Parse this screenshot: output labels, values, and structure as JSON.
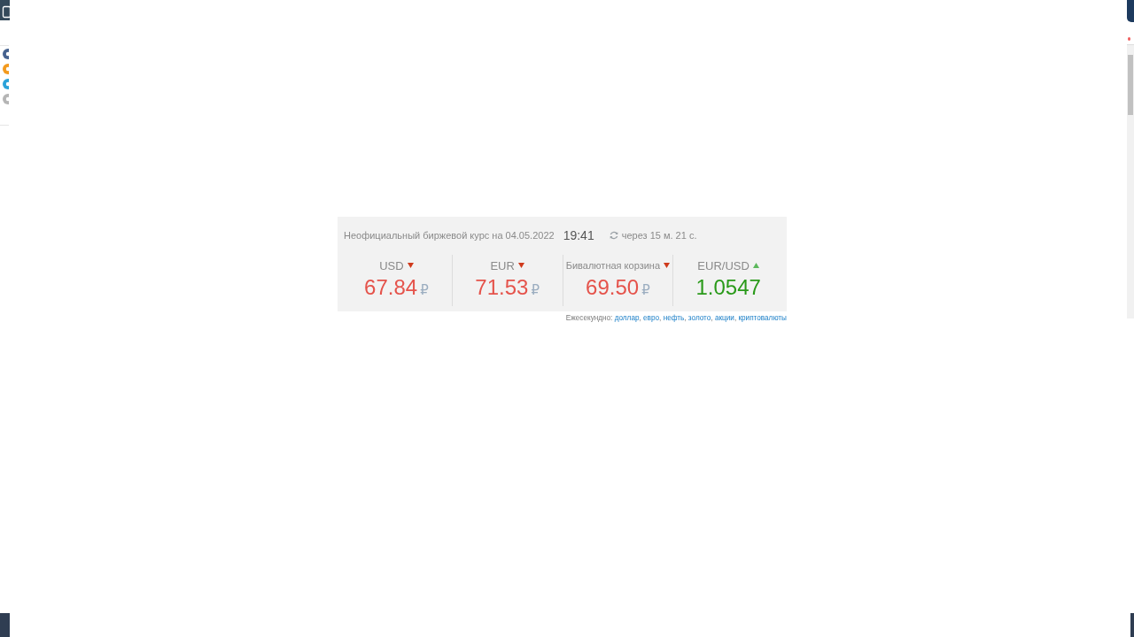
{
  "header": {
    "caption": "Неофициальный биржевой курс на 04.05.2022",
    "time": "19:41",
    "countdown": "через 15 м. 21 с."
  },
  "rates": [
    {
      "label": "USD",
      "kind": "down",
      "value": "67.84",
      "currency": "₽"
    },
    {
      "label": "EUR",
      "kind": "down",
      "value": "71.53",
      "currency": "₽"
    },
    {
      "label": "Бивалютная корзина",
      "kind": "down",
      "value": "69.50",
      "currency": "₽"
    },
    {
      "label": "EUR/USD",
      "kind": "up",
      "value": "1.0547"
    }
  ],
  "footer": {
    "label": "Ежесекундно:",
    "separator": ",",
    "links": [
      "доллар",
      "евро",
      "нефть",
      "золото",
      "акции",
      "криптовалюты"
    ]
  }
}
